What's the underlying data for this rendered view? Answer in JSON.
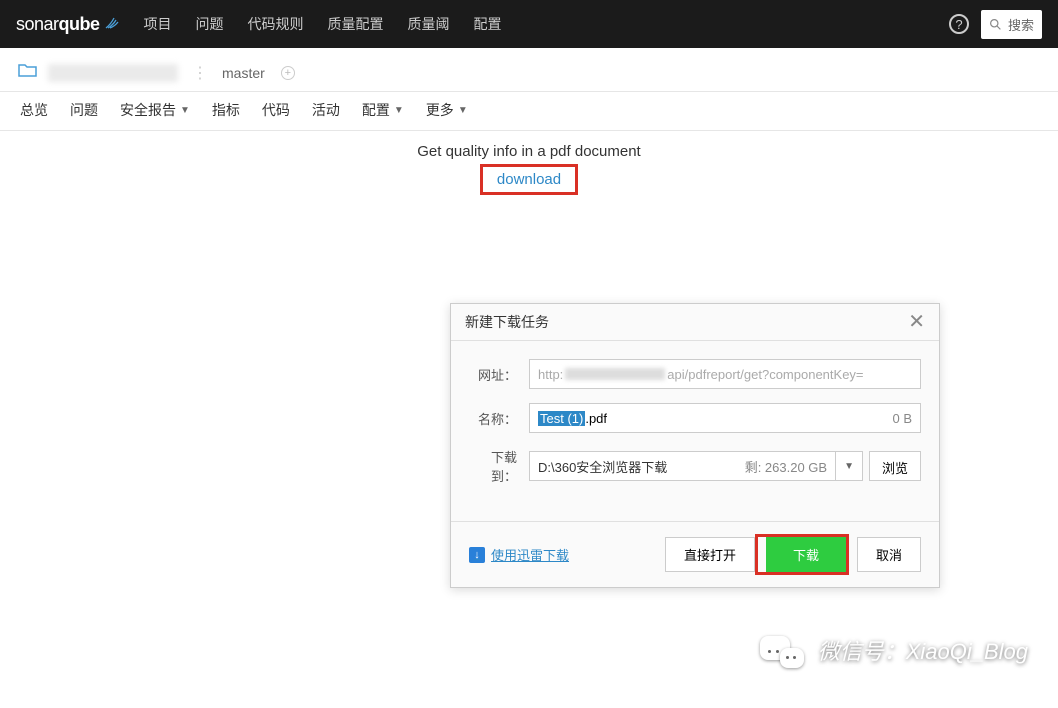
{
  "topnav": {
    "logo_a": "sonar",
    "logo_b": "qube",
    "items": [
      "项目",
      "问题",
      "代码规则",
      "质量配置",
      "质量阈",
      "配置"
    ],
    "search_placeholder": "搜索"
  },
  "subheader": {
    "branch": "master"
  },
  "tabs": {
    "items": [
      "总览",
      "问题",
      "安全报告",
      "指标",
      "代码",
      "活动",
      "配置",
      "更多"
    ],
    "with_caret": [
      2,
      6,
      7
    ]
  },
  "content": {
    "heading": "Get quality info in a pdf document",
    "download": "download"
  },
  "dialog": {
    "title": "新建下载任务",
    "url_label": "网址：",
    "url_prefix": "http:",
    "url_suffix": "api/pdfreport/get?componentKey=",
    "name_label": "名称：",
    "name_selected": "Test (1)",
    "name_ext": ".pdf",
    "name_size": "0 B",
    "path_label": "下载到：",
    "path_value": "D:\\360安全浏览器下载",
    "path_remain": "剩: 263.20 GB",
    "browse": "浏览",
    "thunder": "使用迅雷下载",
    "open_direct": "直接打开",
    "download_btn": "下载",
    "cancel": "取消"
  },
  "watermark": {
    "label": "微信号：XiaoQi_Blog"
  }
}
